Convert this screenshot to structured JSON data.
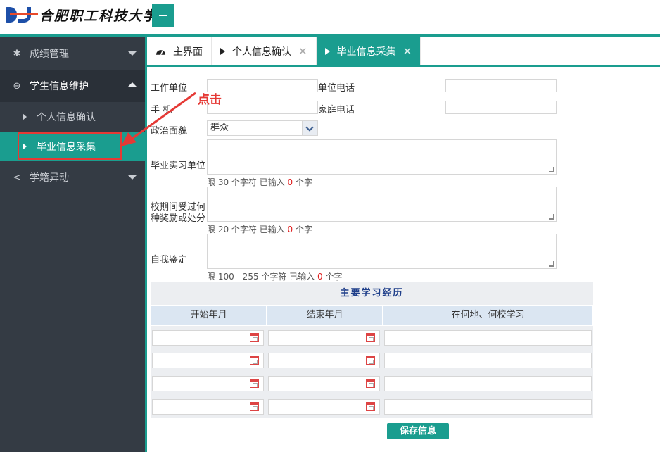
{
  "header": {
    "logo_text": "合肥职工科技大学"
  },
  "sidebar": {
    "items": [
      {
        "label": "成绩管理",
        "icon": "gear-icon"
      },
      {
        "label": "学生信息维护",
        "icon": "minus-circle-icon"
      },
      {
        "label": "个人信息确认"
      },
      {
        "label": "毕业信息采集"
      },
      {
        "label": "学籍异动",
        "icon": "share-icon"
      }
    ]
  },
  "tabs": [
    {
      "label": "主界面",
      "icon": "dashboard-icon"
    },
    {
      "label": "个人信息确认",
      "close": "✕"
    },
    {
      "label": "毕业信息采集",
      "close": "✕"
    }
  ],
  "annotation": {
    "text": "点击",
    "color": "#e53935"
  },
  "form": {
    "work_unit_label": "工作单位",
    "work_unit_value": "",
    "unit_phone_label": "单位电话",
    "unit_phone_value": "",
    "mobile_label": "手 机",
    "mobile_value": "",
    "home_phone_label": "家庭电话",
    "home_phone_value": "",
    "political_label": "政治面貌",
    "political_value": "群众",
    "intern_label": "毕业实习单位",
    "intern_hint": {
      "before": "限 30 个字符 已输入 ",
      "count": "0",
      "after": " 个字"
    },
    "awards_label_1": "校期间受过何",
    "awards_label_2": "种奖励或处分",
    "awards_hint": {
      "before": "限 20 个字符 已输入 ",
      "count": "0",
      "after": " 个字"
    },
    "self_label": "自我鉴定",
    "self_hint": {
      "before": "限 100 - 255 个字符 已输入 ",
      "count": "0",
      "after": " 个字"
    }
  },
  "study": {
    "title": "主要学习经历",
    "columns": [
      "开始年月",
      "结束年月",
      "在何地、何校学习"
    ],
    "rows": [
      [
        "",
        "",
        ""
      ],
      [
        "",
        "",
        ""
      ],
      [
        "",
        "",
        ""
      ],
      [
        "",
        "",
        ""
      ]
    ]
  },
  "save_label": "保存信息",
  "colors": {
    "accent": "#1a9d8f",
    "sidebar": "#343b44",
    "annotation": "#e53935"
  }
}
